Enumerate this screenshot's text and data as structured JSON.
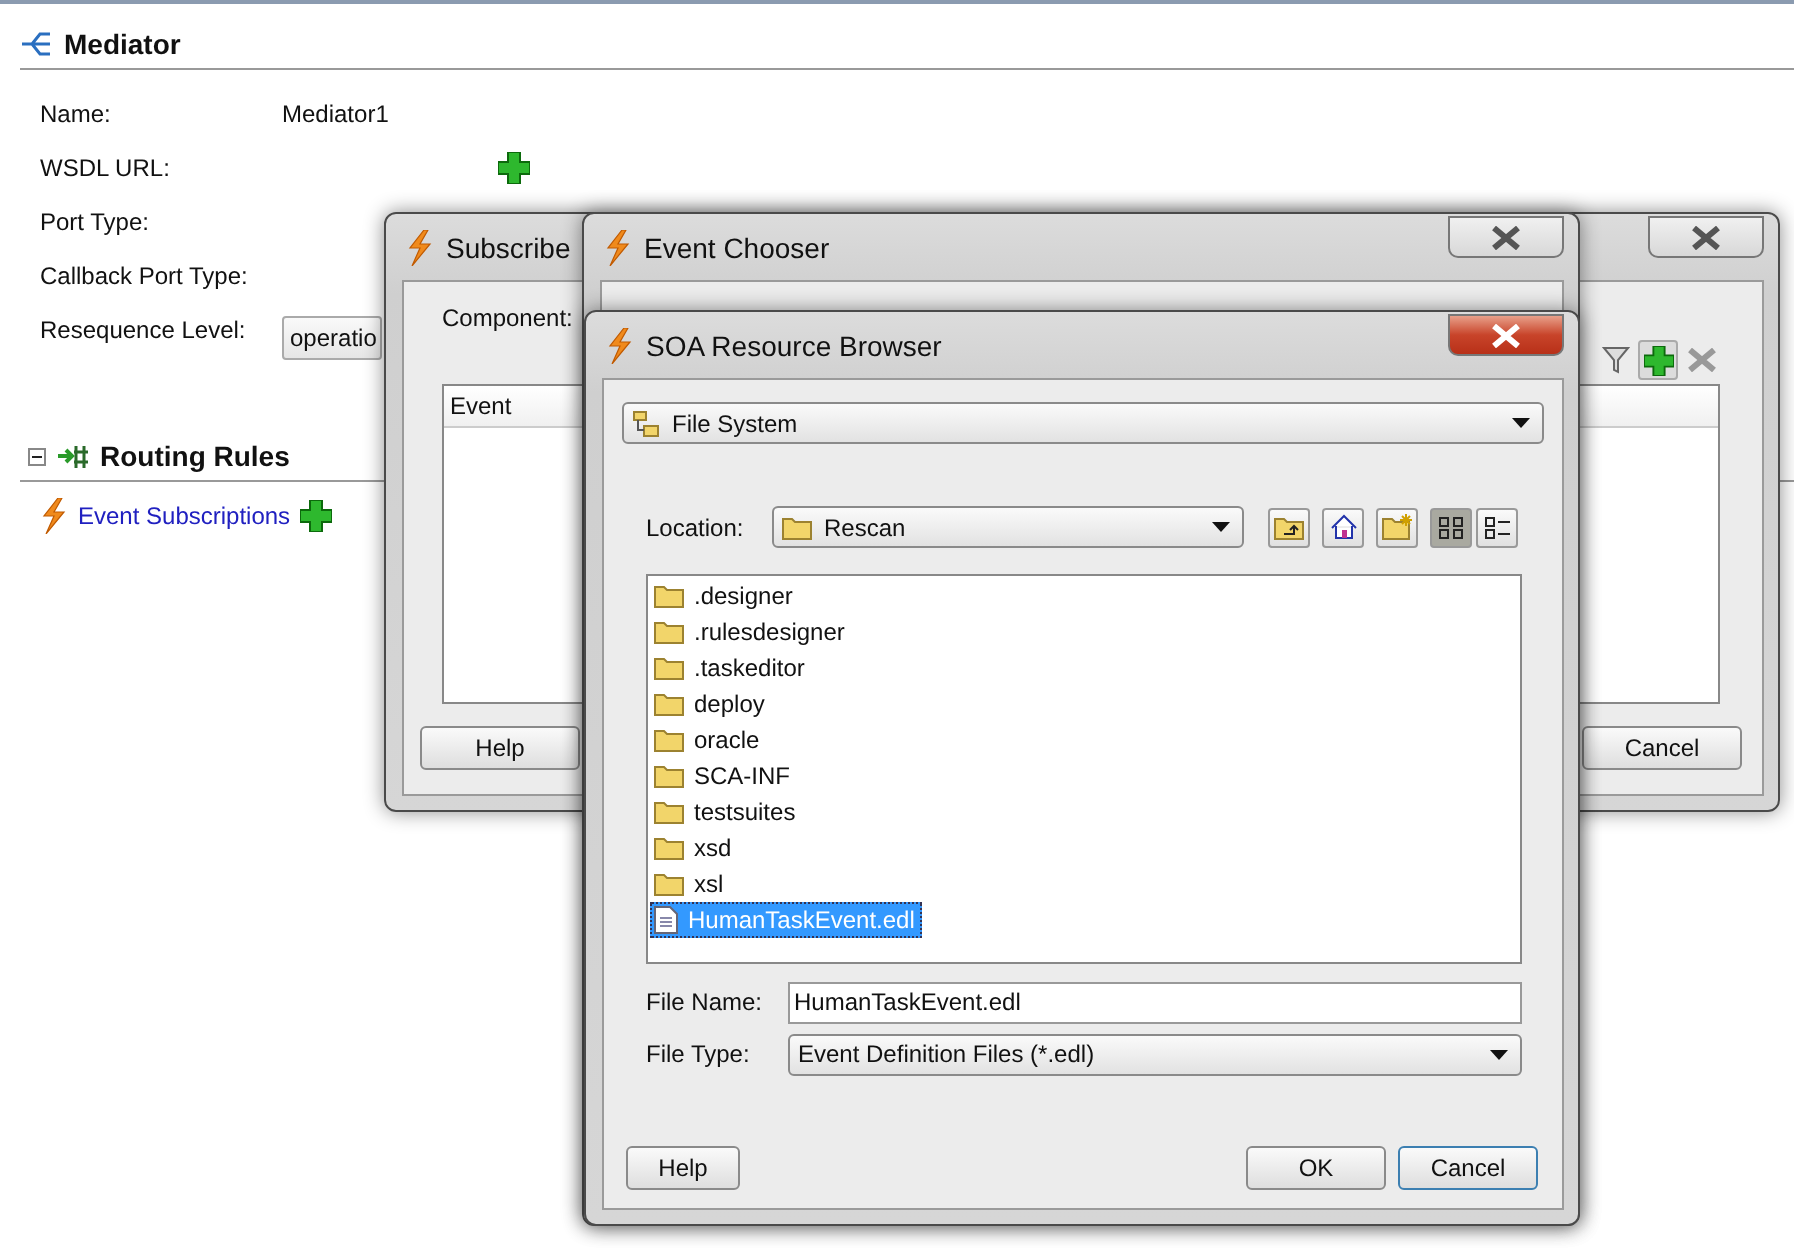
{
  "mediator": {
    "title": "Mediator",
    "fields": [
      {
        "label": "Name:",
        "kind": "text",
        "value": "Mediator1"
      },
      {
        "label": "WSDL URL:",
        "kind": "add"
      },
      {
        "label": "Port Type:",
        "kind": "empty"
      },
      {
        "label": "Callback Port Type:",
        "kind": "empty"
      },
      {
        "label": "Resequence Level:",
        "kind": "select",
        "value": "operatio"
      }
    ]
  },
  "routing_rules": {
    "title": "Routing Rules",
    "expanded": true,
    "link": "Event Subscriptions"
  },
  "subscribed_dialog": {
    "title": "Subscribe",
    "component_label": "Component:",
    "column": "Event",
    "buttons": [
      "Help",
      "Cancel"
    ]
  },
  "event_chooser": {
    "title": "Event Chooser"
  },
  "resource_browser": {
    "title": "SOA Resource Browser",
    "source": "File System",
    "location_label": "Location:",
    "location": "Rescan",
    "view_modes": [
      {
        "kind": "icons",
        "selected": true
      },
      {
        "kind": "details",
        "selected": false
      }
    ],
    "files": [
      {
        "name": ".designer",
        "kind": "folder",
        "selected": false
      },
      {
        "name": ".rulesdesigner",
        "kind": "folder",
        "selected": false
      },
      {
        "name": ".taskeditor",
        "kind": "folder",
        "selected": false
      },
      {
        "name": "deploy",
        "kind": "folder",
        "selected": false
      },
      {
        "name": "oracle",
        "kind": "folder",
        "selected": false
      },
      {
        "name": "SCA-INF",
        "kind": "folder",
        "selected": false
      },
      {
        "name": "testsuites",
        "kind": "folder",
        "selected": false
      },
      {
        "name": "xsd",
        "kind": "folder",
        "selected": false
      },
      {
        "name": "xsl",
        "kind": "folder",
        "selected": false
      },
      {
        "name": "HumanTaskEvent.edl",
        "kind": "file",
        "selected": true
      }
    ],
    "file_name_label": "File Name:",
    "file_name": "HumanTaskEvent.edl",
    "file_type_label": "File Type:",
    "file_type": "Event Definition Files (*.edl)",
    "buttons": [
      {
        "label": "Help",
        "focused": false
      },
      {
        "label": "OK",
        "focused": false
      },
      {
        "label": "Cancel",
        "focused": true
      }
    ]
  }
}
